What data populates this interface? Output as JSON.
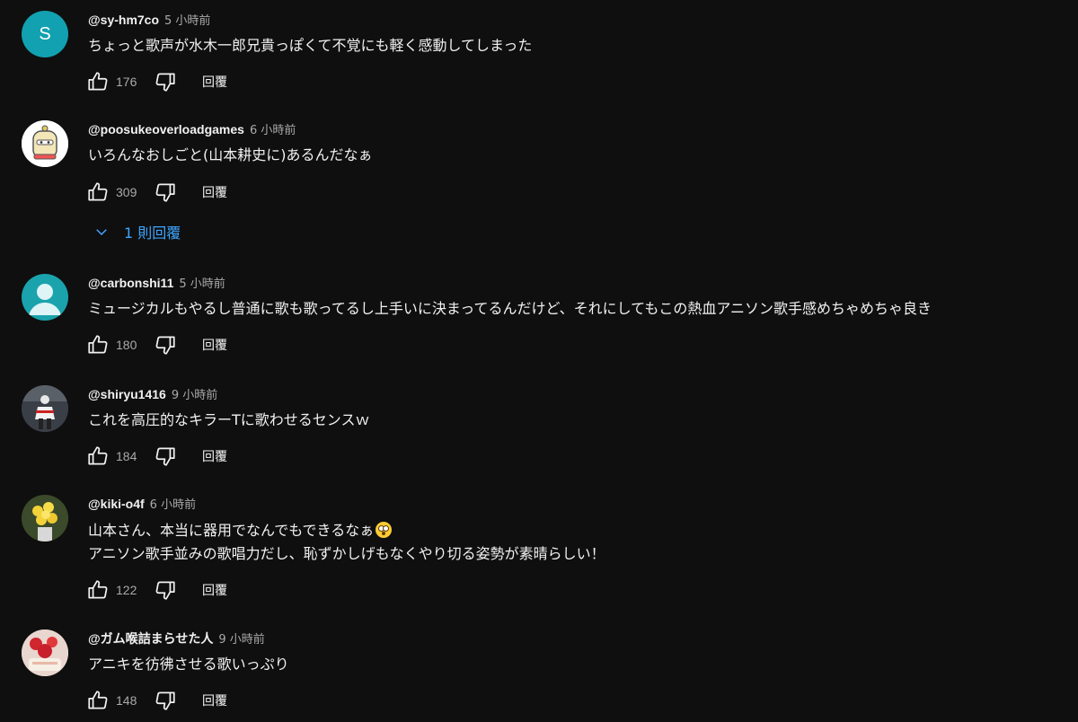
{
  "comments": [
    {
      "author": "@sy-hm7co",
      "time": "5 小時前",
      "avatar_letter": "S",
      "lines": [
        "ちょっと歌声が水木一郎兄貴っぽくて不覚にも軽く感動してしまった"
      ],
      "likes": "176",
      "reply_label": "回覆"
    },
    {
      "author": "@poosukeoverloadgames",
      "time": "6 小時前",
      "lines": [
        "いろんなおしごと(山本耕史に)あるんだなぁ"
      ],
      "likes": "309",
      "reply_label": "回覆",
      "replies_toggle": "1 則回覆"
    },
    {
      "author": "@carbonshi11",
      "time": "5 小時前",
      "lines": [
        "ミュージカルもやるし普通に歌も歌ってるし上手いに決まってるんだけど、それにしてもこの熱血アニソン歌手感めちゃめちゃ良き"
      ],
      "likes": "180",
      "reply_label": "回覆"
    },
    {
      "author": "@shiryu1416",
      "time": "9 小時前",
      "lines": [
        "これを高圧的なキラーTに歌わせるセンスｗ"
      ],
      "likes": "184",
      "reply_label": "回覆"
    },
    {
      "author": "@kiki-o4f",
      "time": "6 小時前",
      "lines": [
        "山本さん、本当に器用でなんでもできるなぁ",
        "アニソン歌手並みの歌唱力だし、恥ずかしげもなくやり切る姿勢が素晴らしい！"
      ],
      "likes": "122",
      "reply_label": "回覆"
    },
    {
      "author": "@ガム喉詰まらせた人",
      "time": "9 小時前",
      "lines": [
        "アニキを彷彿させる歌いっぷり"
      ],
      "likes": "148",
      "reply_label": "回覆"
    }
  ],
  "colors": {
    "background": "#0f0f0f",
    "text": "#f1f1f1",
    "secondary": "#aaaaaa",
    "link": "#3ea6ff"
  }
}
